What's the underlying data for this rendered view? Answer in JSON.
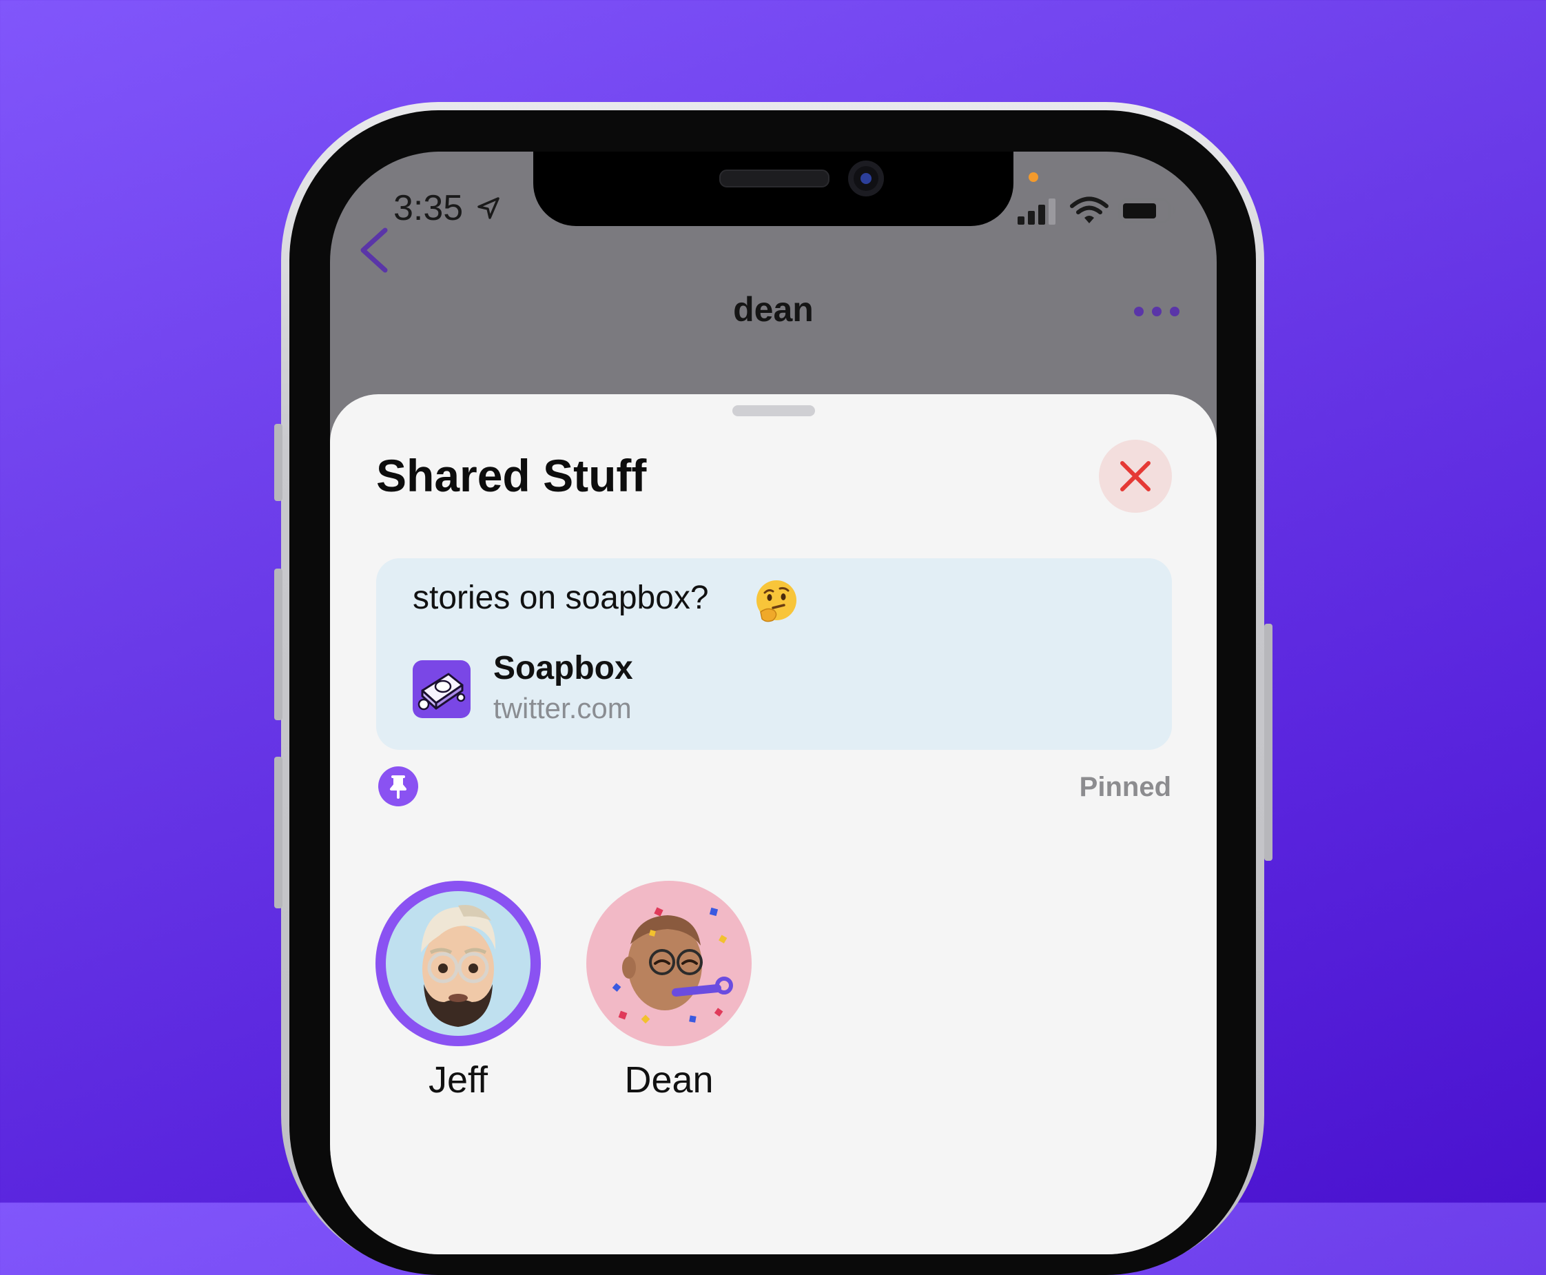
{
  "status_bar": {
    "time": "3:35",
    "location_icon": "location-arrow-icon",
    "signal_icon": "cellular-signal-icon",
    "wifi_icon": "wifi-icon",
    "battery_icon": "battery-icon"
  },
  "nav": {
    "back_icon": "chevron-left-icon",
    "title": "dean",
    "more_icon": "ellipsis-icon"
  },
  "sheet": {
    "title": "Shared Stuff",
    "close_icon": "close-x-icon",
    "item": {
      "message": "stories on soapbox?",
      "emoji": "thinking-face",
      "link_icon": "soapbox-app-icon",
      "link_title": "Soapbox",
      "link_domain": "twitter.com"
    },
    "pin_icon": "pushpin-icon",
    "pinned_label": "Pinned",
    "members": [
      {
        "name": "Jeff",
        "selected": true
      },
      {
        "name": "Dean",
        "selected": false
      }
    ]
  },
  "colors": {
    "accent": "#8a52f2",
    "close_red": "#e53935",
    "card_bg": "#e2eef5",
    "background": "#6a3ae8"
  }
}
